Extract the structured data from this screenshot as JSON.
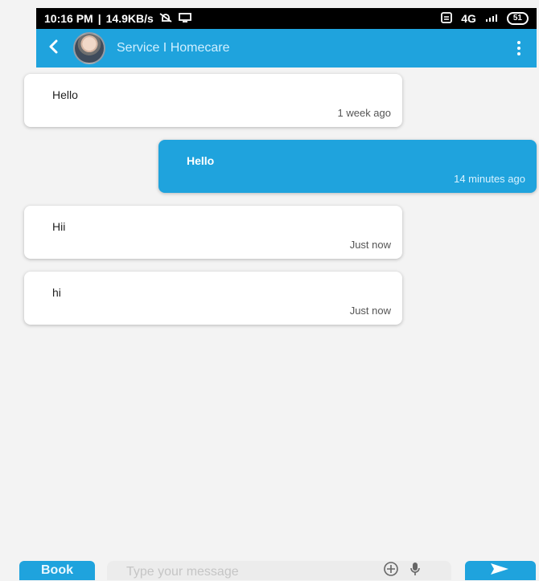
{
  "status_bar": {
    "time": "10:16 PM",
    "speed": "14.9KB/s",
    "network": "4G",
    "battery": "51"
  },
  "header": {
    "title": "Service I Homecare"
  },
  "chat": {
    "messages": [
      {
        "text": "Hello",
        "time": "1 week ago",
        "side": "left"
      },
      {
        "text": "Hello",
        "time": "14 minutes ago",
        "side": "right"
      },
      {
        "text": "Hii",
        "time": "Just now",
        "side": "left"
      },
      {
        "text": "hi",
        "time": "Just now",
        "side": "left"
      }
    ]
  },
  "composer": {
    "book_label": "Book",
    "placeholder": "Type your message"
  },
  "colors": {
    "accent": "#1fa3dd",
    "background": "#f3f3f3"
  },
  "icons": {
    "back": "chevron-left-icon",
    "menu": "more-vertical-icon",
    "add": "plus-circle-icon",
    "mic": "mic-icon",
    "send": "send-icon"
  }
}
